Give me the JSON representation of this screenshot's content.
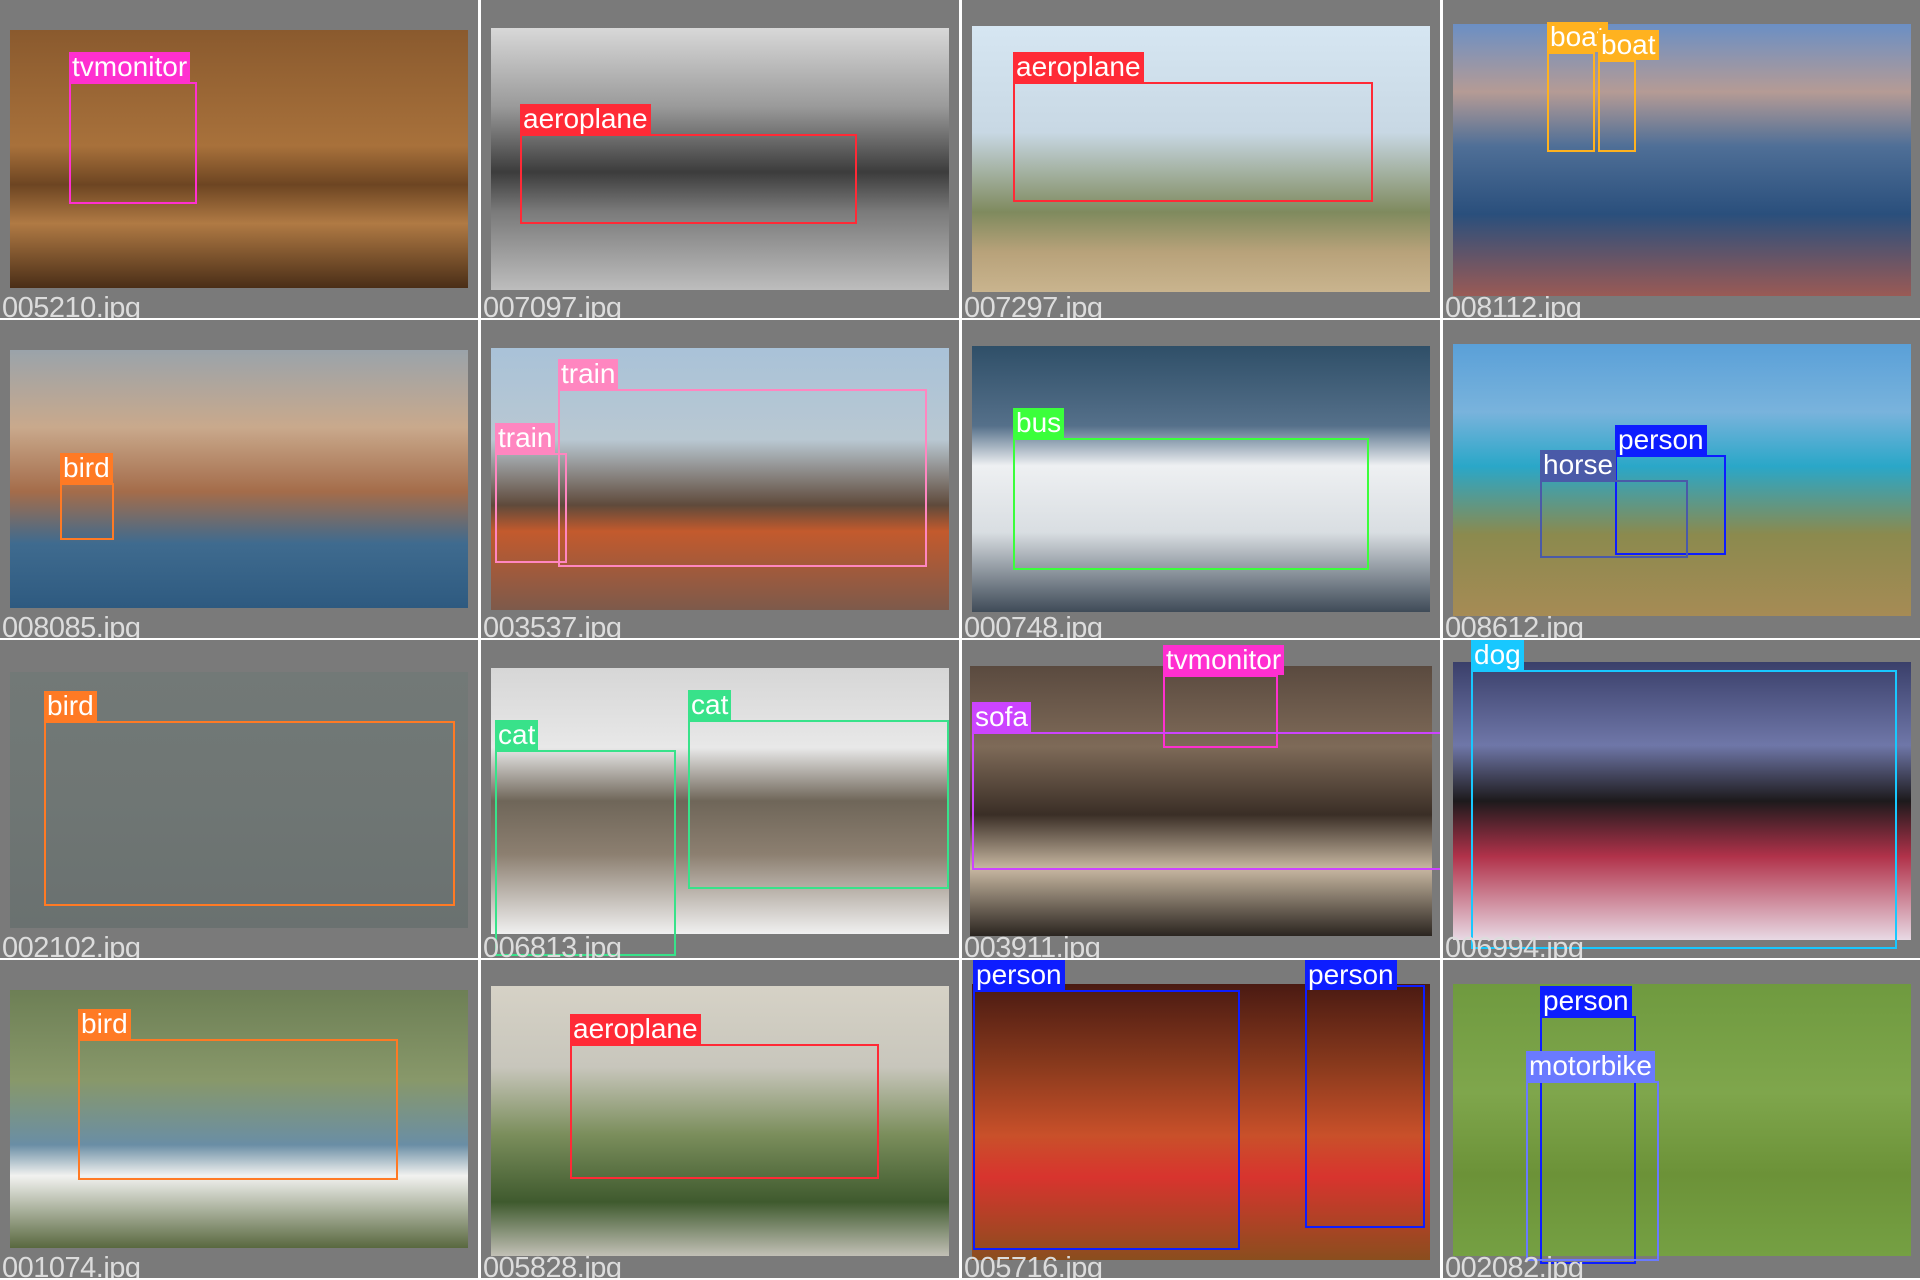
{
  "title": "",
  "tiles": [
    {
      "filename": "005210.jpg",
      "detections": [
        {
          "label": "tvmonitor",
          "color": "#ff2fd0"
        }
      ]
    },
    {
      "filename": "007097.jpg",
      "detections": [
        {
          "label": "aeroplane",
          "color": "#ff2a36"
        }
      ]
    },
    {
      "filename": "007297.jpg",
      "detections": [
        {
          "label": "aeroplane",
          "color": "#ff2a36"
        }
      ]
    },
    {
      "filename": "008112.jpg",
      "detections": [
        {
          "label": "boat",
          "color": "#ffb21f"
        },
        {
          "label": "boat",
          "color": "#ffb21f"
        }
      ]
    },
    {
      "filename": "008085.jpg",
      "detections": [
        {
          "label": "bird",
          "color": "#ff7a24"
        }
      ]
    },
    {
      "filename": "003537.jpg",
      "detections": [
        {
          "label": "train",
          "color": "#ff86c0"
        },
        {
          "label": "train",
          "color": "#ff86c0"
        }
      ]
    },
    {
      "filename": "000748.jpg",
      "detections": [
        {
          "label": "bus",
          "color": "#3bff3b"
        }
      ]
    },
    {
      "filename": "008612.jpg",
      "detections": [
        {
          "label": "person",
          "color": "#0d1dff"
        },
        {
          "label": "horse",
          "color": "#4a5aa8"
        }
      ]
    },
    {
      "filename": "002102.jpg",
      "detections": [
        {
          "label": "bird",
          "color": "#ff7a24"
        }
      ]
    },
    {
      "filename": "006813.jpg",
      "detections": [
        {
          "label": "cat",
          "color": "#38e28a"
        },
        {
          "label": "cat",
          "color": "#38e28a"
        }
      ]
    },
    {
      "filename": "003911.jpg",
      "detections": [
        {
          "label": "tvmonitor",
          "color": "#ff2fd0"
        },
        {
          "label": "sofa",
          "color": "#cc44ff"
        }
      ]
    },
    {
      "filename": "006994.jpg",
      "detections": [
        {
          "label": "dog",
          "color": "#18c8ff"
        }
      ]
    },
    {
      "filename": "001074.jpg",
      "detections": [
        {
          "label": "bird",
          "color": "#ff7a24"
        }
      ]
    },
    {
      "filename": "005828.jpg",
      "detections": [
        {
          "label": "aeroplane",
          "color": "#ff2a36"
        }
      ]
    },
    {
      "filename": "005716.jpg",
      "detections": [
        {
          "label": "person",
          "color": "#0d1dff"
        },
        {
          "label": "person",
          "color": "#0d1dff"
        }
      ]
    },
    {
      "filename": "002082.jpg",
      "detections": [
        {
          "label": "person",
          "color": "#0d1dff"
        },
        {
          "label": "motorbike",
          "color": "#6a7aff"
        }
      ]
    }
  ]
}
